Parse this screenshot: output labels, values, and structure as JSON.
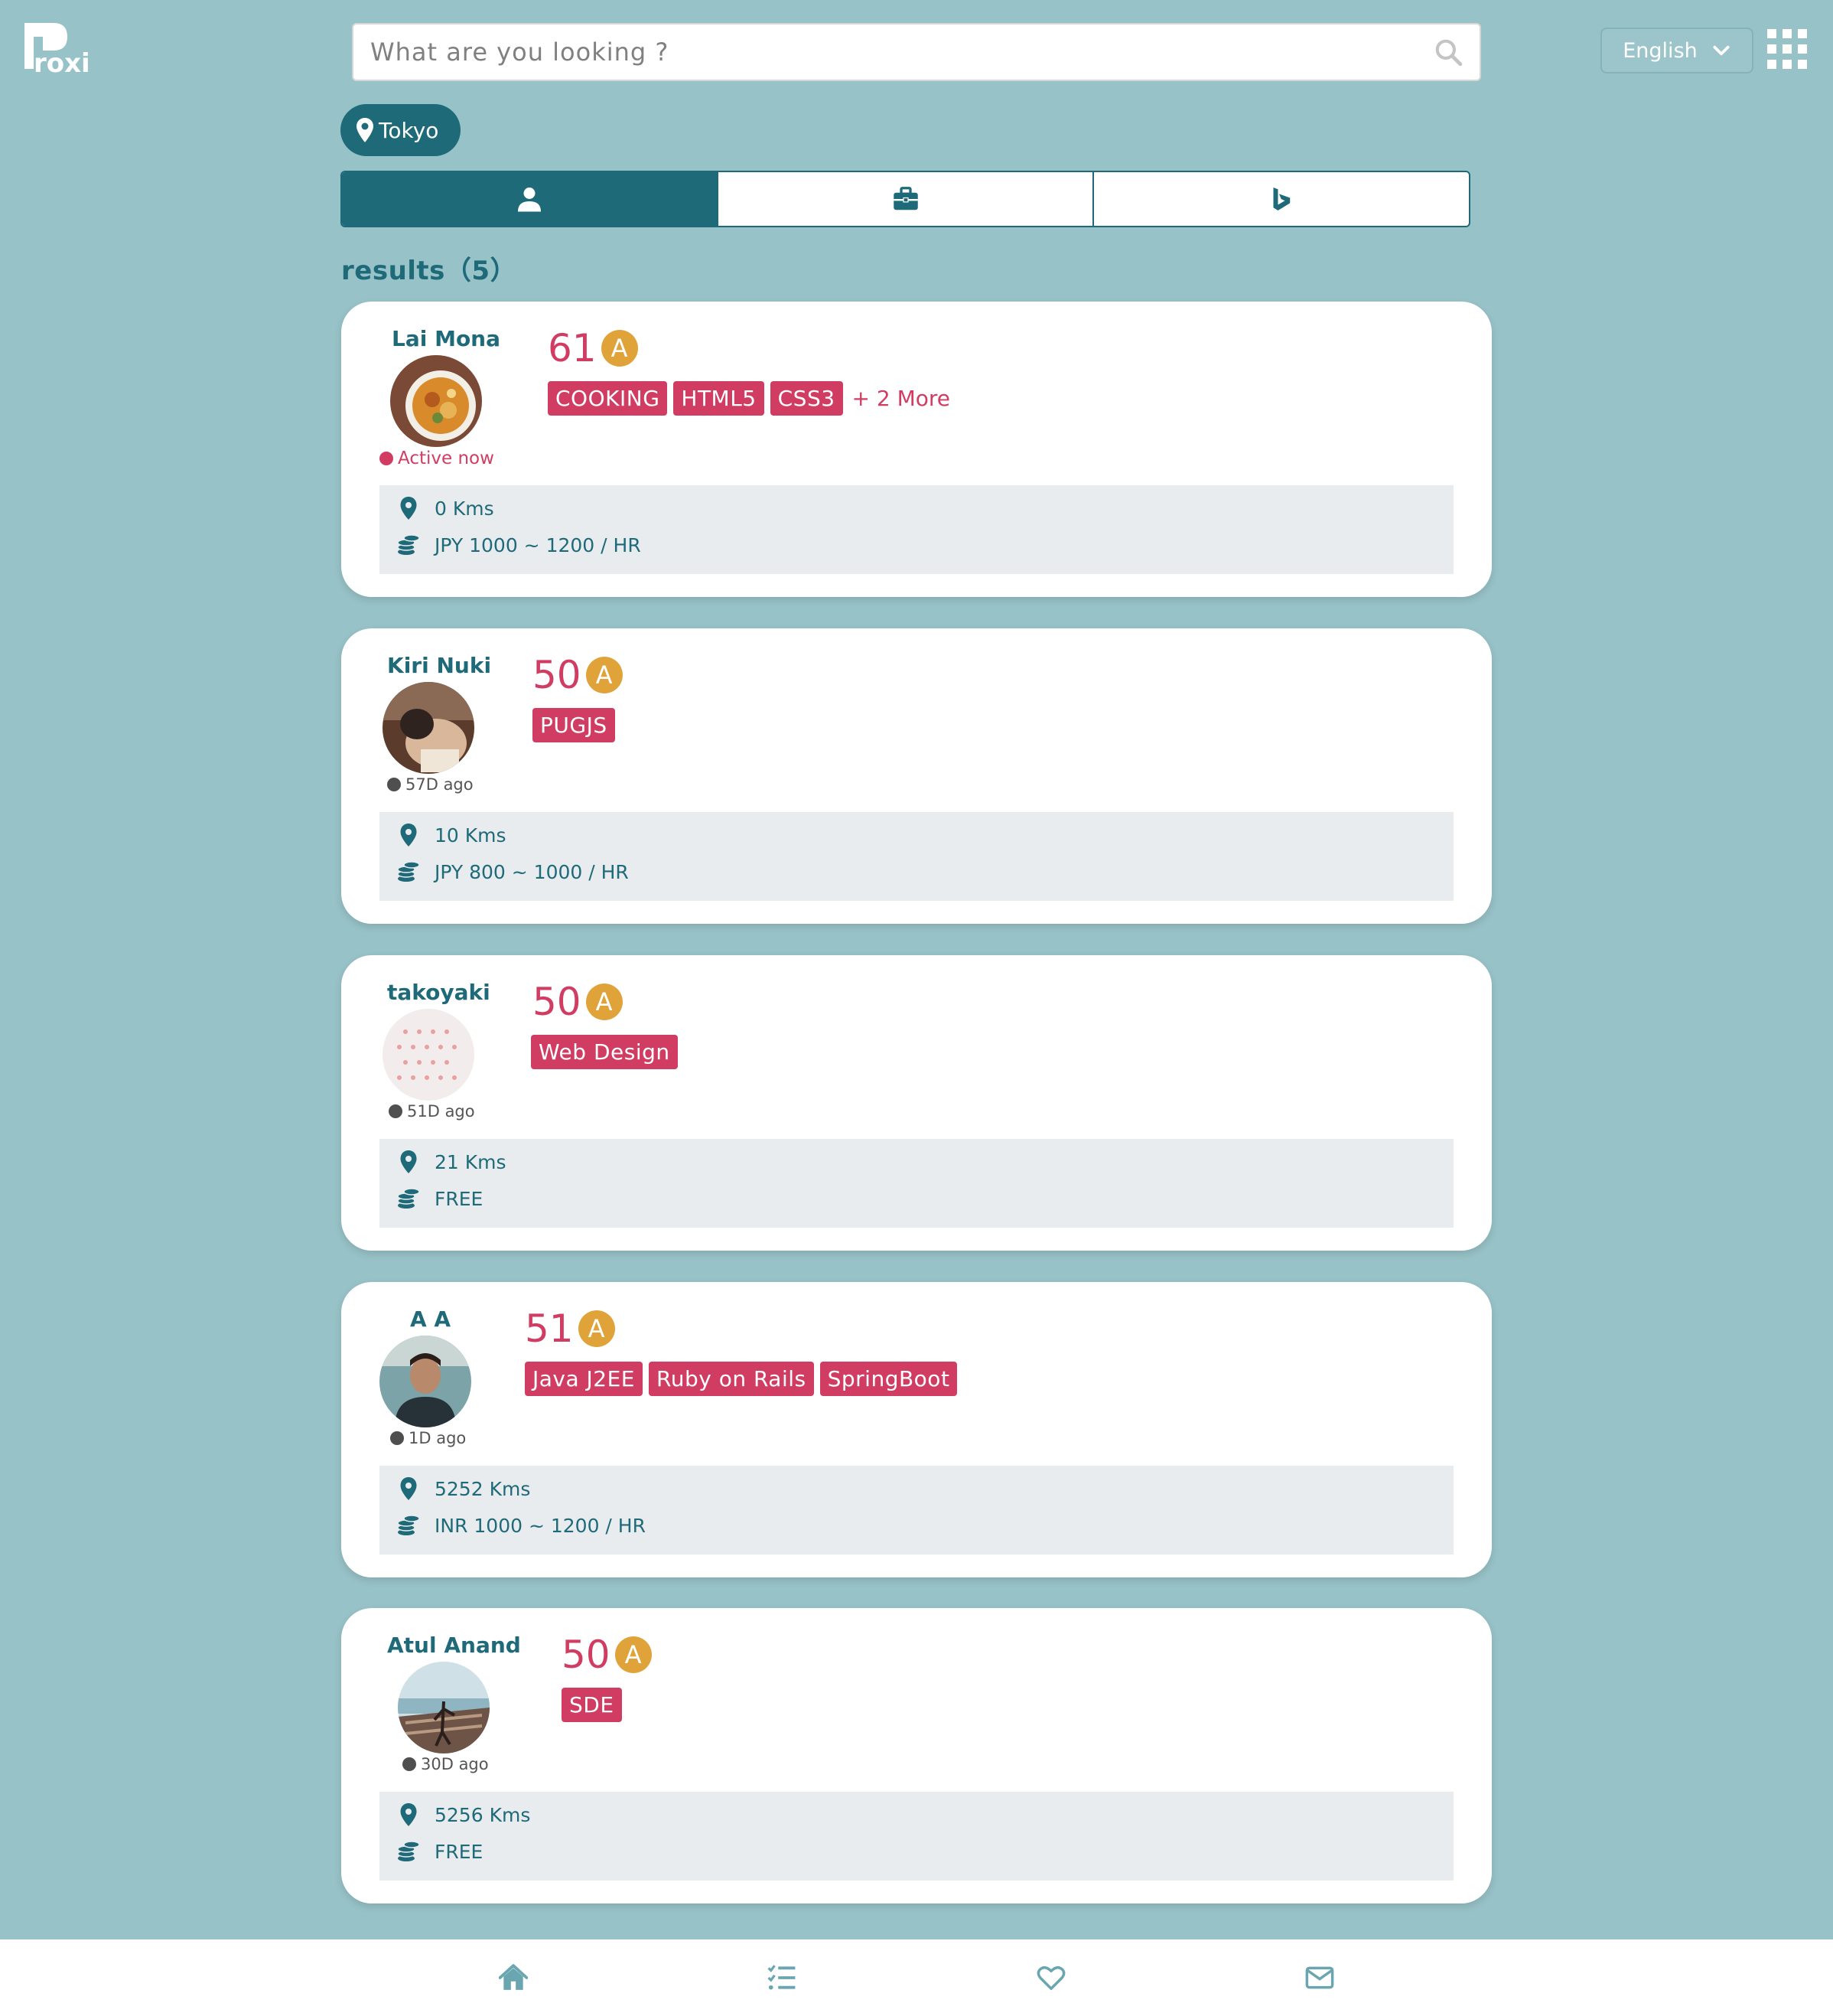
{
  "app": {
    "logo_text": "Proxi"
  },
  "search": {
    "placeholder": "What are you looking ?"
  },
  "language": {
    "selected": "English"
  },
  "location": {
    "label": "Tokyo"
  },
  "tabs": [
    {
      "icon": "user-icon",
      "active": true
    },
    {
      "icon": "briefcase-icon",
      "active": false
    },
    {
      "icon": "bing-icon",
      "active": false
    }
  ],
  "results": {
    "label": "results（5）"
  },
  "cards": [
    {
      "name": "Lai Mona",
      "status": "Active now",
      "score": "61",
      "grade": "A",
      "tags": [
        "COOKING",
        "HTML5",
        "CSS3"
      ],
      "more": "+ 2 More",
      "distance": "0 Kms",
      "rate": "JPY 1000 ~ 1200 / HR"
    },
    {
      "name": "Kiri Nuki",
      "status": "57D ago",
      "score": "50",
      "grade": "A",
      "tags": [
        "PUGJS"
      ],
      "distance": "10 Kms",
      "rate": "JPY 800 ~ 1000 / HR"
    },
    {
      "name": "takoyaki",
      "status": "51D ago",
      "score": "50",
      "grade": "A",
      "tags": [
        "Web Design"
      ],
      "distance": "21 Kms",
      "rate": "FREE"
    },
    {
      "name": "A A",
      "status": "1D ago",
      "score": "51",
      "grade": "A",
      "tags": [
        "Java J2EE",
        "Ruby on Rails",
        "SpringBoot"
      ],
      "distance": "5252 Kms",
      "rate": "INR 1000 ~ 1200 / HR"
    },
    {
      "name": "Atul Anand",
      "status": "30D ago",
      "score": "50",
      "grade": "A",
      "tags": [
        "SDE"
      ],
      "distance": "5256 Kms",
      "rate": "FREE"
    }
  ],
  "bottom_nav": [
    {
      "icon": "home-icon"
    },
    {
      "icon": "task-list-icon"
    },
    {
      "icon": "heart-icon"
    },
    {
      "icon": "envelope-icon"
    }
  ],
  "colors": {
    "background": "#97c2c7",
    "primary": "#1f6a78",
    "accent": "#d13d62",
    "grade": "#e0a33a"
  }
}
